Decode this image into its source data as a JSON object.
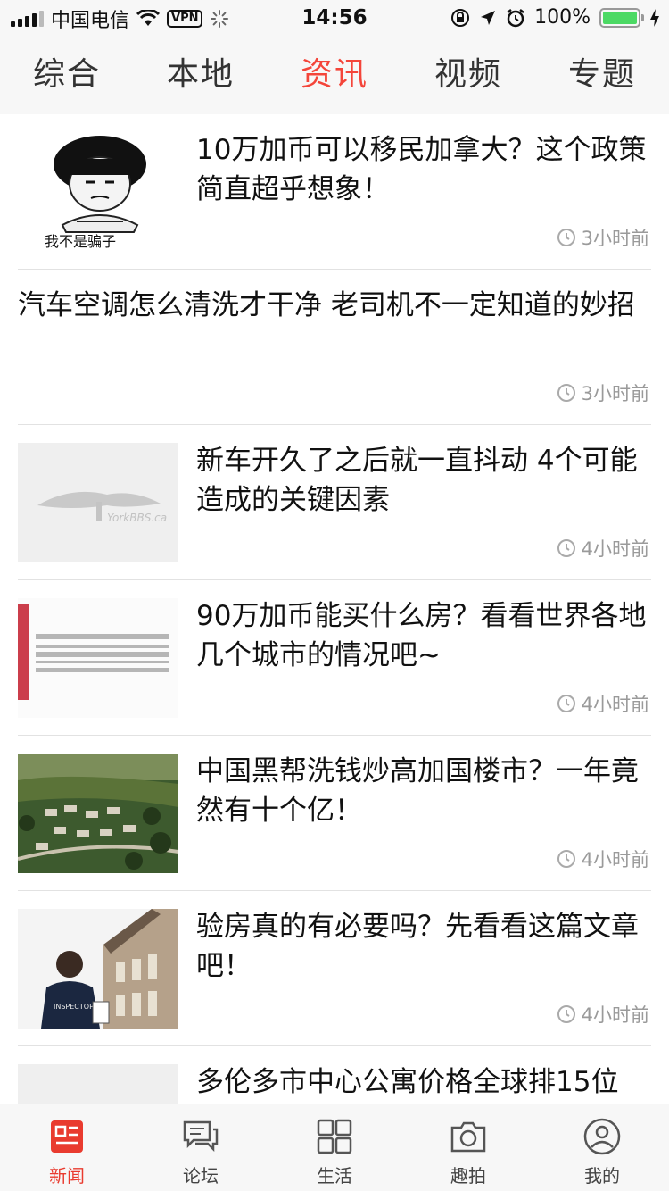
{
  "status_bar": {
    "carrier": "中国电信",
    "vpn": "VPN",
    "time": "14:56",
    "battery": "100%",
    "battery_level": 1.0
  },
  "tabs": [
    {
      "label": "综合"
    },
    {
      "label": "本地"
    },
    {
      "label": "资讯",
      "active": true
    },
    {
      "label": "视频"
    },
    {
      "label": "专题"
    }
  ],
  "news": [
    {
      "title": "10万加币可以移民加拿大？这个政策简直超乎想象！",
      "time": "3小时前",
      "thumb": "meme-face",
      "thumb_caption": "我不是骗子"
    },
    {
      "title": "汽车空调怎么清洗才干净 老司机不一定知道的妙招",
      "time": "3小时前",
      "thumb": null
    },
    {
      "title": "新车开久了之后就一直抖动 4个可能造成的关键因素",
      "time": "4小时前",
      "thumb": "site-watermark",
      "thumb_caption": "YorkBBS.ca"
    },
    {
      "title": "90万加币能买什么房？看看世界各地几个城市的情况吧~",
      "time": "4小时前",
      "thumb": "blurred-banner"
    },
    {
      "title": "中国黑帮洗钱炒高加国楼市？一年竟然有十个亿！",
      "time": "4小时前",
      "thumb": "aerial-houses"
    },
    {
      "title": "验房真的有必要吗？先看看这篇文章吧！",
      "time": "4小时前",
      "thumb": "inspector",
      "thumb_caption": "INSPECTOR"
    },
    {
      "title": "多伦多市中心公寓价格全球排15位",
      "time": "",
      "thumb": "gray-placeholder"
    }
  ],
  "bottom_tabs": [
    {
      "label": "新闻",
      "icon": "news-icon",
      "active": true
    },
    {
      "label": "论坛",
      "icon": "forum-icon"
    },
    {
      "label": "生活",
      "icon": "grid-icon"
    },
    {
      "label": "趣拍",
      "icon": "camera-icon"
    },
    {
      "label": "我的",
      "icon": "user-icon"
    }
  ],
  "colors": {
    "accent": "#f4453a",
    "battery": "#4cd964"
  }
}
